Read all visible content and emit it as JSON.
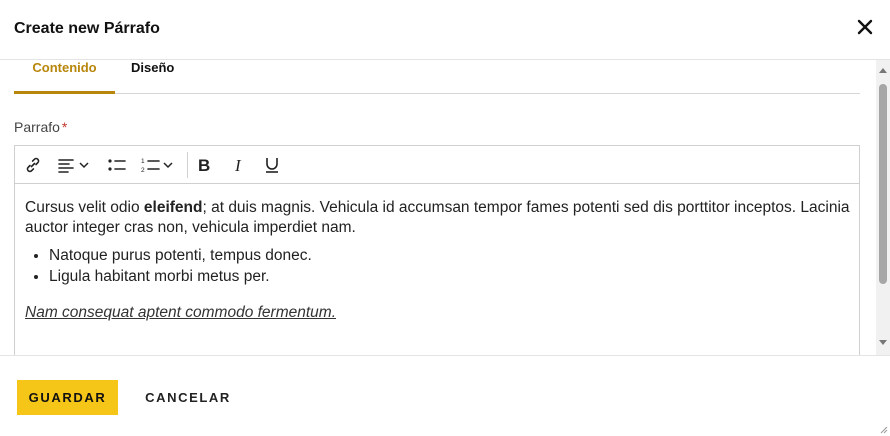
{
  "dialog": {
    "title": "Create new Párrafo",
    "close_icon": "close-icon"
  },
  "tabs": [
    {
      "label": "Contenido",
      "active": true
    },
    {
      "label": "Diseño",
      "active": false
    }
  ],
  "field": {
    "label": "Parrafo",
    "required_mark": "*"
  },
  "toolbar": {
    "icons": [
      "link-icon",
      "align-left-icon",
      "chevron-down-icon",
      "bullet-list-icon",
      "numbered-list-icon",
      "chevron-down-icon",
      "bold-icon",
      "italic-icon",
      "underline-icon"
    ]
  },
  "content": {
    "p1_before": "Cursus velit odio ",
    "p1_bold": "eleifend",
    "p1_after": "; at duis magnis. Vehicula id accumsan tempor fames potenti sed dis porttitor inceptos. Lacinia auctor integer cras non, vehicula imperdiet nam.",
    "list": [
      "Natoque purus potenti, tempus donec.",
      "Ligula habitant morbi metus per."
    ],
    "p2": "Nam consequat aptent commodo fermentum."
  },
  "footer": {
    "save_label": "GUARDAR",
    "cancel_label": "CANCELAR"
  },
  "colors": {
    "accent": "#b8860b",
    "save_button": "#f5c518"
  }
}
